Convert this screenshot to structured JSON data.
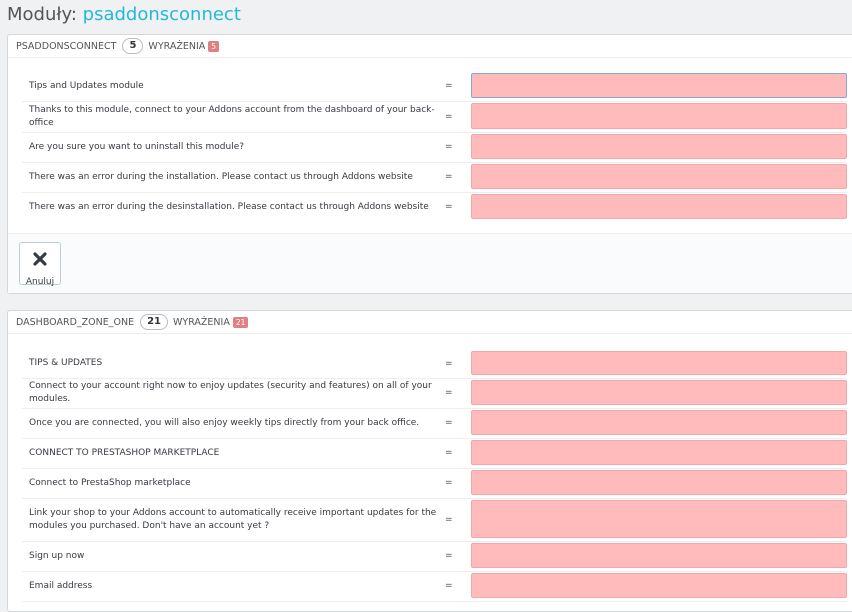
{
  "page": {
    "title_prefix": "Moduły:",
    "module_name": "psaddonsconnect"
  },
  "panels": [
    {
      "name": "PSADDONSCONNECT",
      "count": "5",
      "expressions_label": "WYRAŻENIA",
      "missing_badge": "5",
      "rows": [
        {
          "label": "Tips and Updates module",
          "eq": "=",
          "value": ""
        },
        {
          "label": "Thanks to this module, connect to your Addons account from the dashboard of your back-office",
          "eq": "=",
          "value": ""
        },
        {
          "label": "Are you sure you want to uninstall this module?",
          "eq": "=",
          "value": ""
        },
        {
          "label": "There was an error during the installation. Please contact us through Addons website",
          "eq": "=",
          "value": ""
        },
        {
          "label": "There was an error during the desinstallation. Please contact us through Addons website",
          "eq": "=",
          "value": ""
        }
      ],
      "cancel_label": "Anuluj"
    },
    {
      "name": "DASHBOARD_ZONE_ONE",
      "count": "21",
      "expressions_label": "WYRAŻENIA",
      "missing_badge": "21",
      "rows": [
        {
          "label": "TIPS & UPDATES",
          "eq": "=",
          "value": ""
        },
        {
          "label": "Connect to your account right now to enjoy updates (security and features) on all of your modules.",
          "eq": "=",
          "value": ""
        },
        {
          "label": "Once you are connected, you will also enjoy weekly tips directly from your back office.",
          "eq": "=",
          "value": ""
        },
        {
          "label": "CONNECT TO PRESTASHOP MARKETPLACE",
          "eq": "=",
          "value": ""
        },
        {
          "label": "Connect to PrestaShop marketplace",
          "eq": "=",
          "value": ""
        },
        {
          "label": "Link your shop to your Addons account to automatically receive important updates for the modules you purchased. Don't have an account yet ?",
          "eq": "=",
          "value": ""
        },
        {
          "label": "Sign up now",
          "eq": "=",
          "value": ""
        },
        {
          "label": "Email address",
          "eq": "=",
          "value": ""
        }
      ]
    }
  ],
  "colors": {
    "accent": "#25b9d7",
    "missing_field": "#ffbbbb",
    "badge": "#e08080"
  }
}
